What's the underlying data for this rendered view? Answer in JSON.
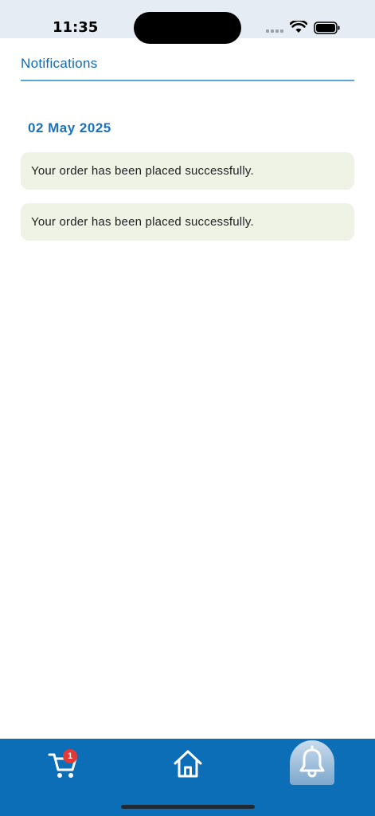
{
  "status_bar": {
    "time": "11:35"
  },
  "header": {
    "title": "Notifications"
  },
  "notifications": {
    "date": "02 May 2025",
    "items": [
      {
        "message": "Your order has been placed successfully."
      },
      {
        "message": "Your order has been placed successfully."
      }
    ]
  },
  "bottom_nav": {
    "cart_badge": "1",
    "items": [
      {
        "icon": "cart-icon"
      },
      {
        "icon": "home-icon"
      },
      {
        "icon": "bell-icon",
        "active": true
      }
    ]
  },
  "colors": {
    "accent": "#1269b0",
    "nav_background": "#0d6eb8",
    "card_background": "#eef3e6",
    "badge": "#e53935"
  }
}
